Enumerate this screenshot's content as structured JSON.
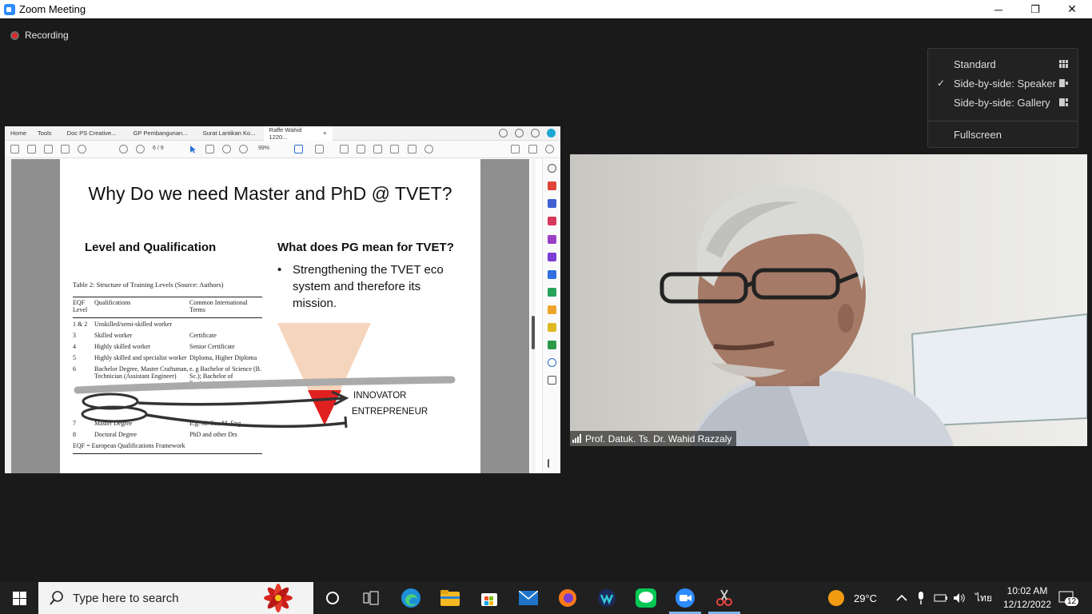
{
  "window": {
    "title": "Zoom Meeting",
    "minimize": "─",
    "restore": "❐",
    "close": "✕"
  },
  "recording": {
    "label": "Recording"
  },
  "view_menu": {
    "items": [
      {
        "label": "Standard",
        "checked": ""
      },
      {
        "label": "Side-by-side: Speaker",
        "checked": "✓"
      },
      {
        "label": "Side-by-side: Gallery",
        "checked": ""
      },
      {
        "label": "Fullscreen",
        "checked": ""
      }
    ]
  },
  "shared_screen": {
    "tabs": [
      {
        "label": "Home"
      },
      {
        "label": "Tools"
      },
      {
        "label": "Doc PS Creative..."
      },
      {
        "label": "GP Pembangunan..."
      },
      {
        "label": "Surat Lantikan Ko..."
      },
      {
        "label": "Raffe Wahid 1220..."
      }
    ],
    "tab_close": "×",
    "page_current": "6",
    "page_total": "/ 9",
    "zoom": "99%",
    "slide": {
      "title": "Why Do we need Master and PhD @ TVET?",
      "left_heading": "Level and Qualification",
      "right_heading": "What does PG mean for TVET?",
      "bullet": "Strengthening the TVET eco system and therefore its mission.",
      "bullet_mark": "•",
      "table_caption": "Table 2:  Structure of Training Levels (Source: Authors)",
      "table_headers": [
        "EQF Level",
        "Qualifications",
        "Common International Terms"
      ],
      "table_rows": [
        [
          "1 & 2",
          "Unskilled/semi-skilled worker",
          ""
        ],
        [
          "3",
          "Skilled worker",
          "Certificate"
        ],
        [
          "4",
          "Highly skilled worker",
          "Senior Certificate"
        ],
        [
          "5",
          "Highly skilled and specialist worker",
          "Diploma, Higher Diploma"
        ],
        [
          "6",
          "Bachelor Degree, Master Craftsman, Technician (Assistant Engineer)",
          "e. g Bachelor of Science (B. Sc.); Bachelor of Engineering"
        ],
        [
          "7",
          "Master Degree",
          "E.g. M. Sc.; M. Eng."
        ],
        [
          "8",
          "Doctoral Degree",
          "PhD and other Drs"
        ]
      ],
      "table_footnote": "EQF = European Qualifications Framework",
      "innovator_label": "INNOVATOR",
      "entrepreneur_label": "ENTREPRENEUR"
    }
  },
  "speaker": {
    "name": "Prof. Datuk. Ts. Dr. Wahid Razzaly"
  },
  "taskbar": {
    "search_placeholder": "Type here to search",
    "weather": "29°C",
    "language": "ไทย",
    "time": "10:02 AM",
    "date": "12/12/2022",
    "notifications": "12"
  },
  "colors": {
    "zoom_blue": "#2d8cff",
    "recording_red": "#e02828",
    "funnel_peach": "#f6d5bd",
    "funnel_red": "#e0201f"
  }
}
